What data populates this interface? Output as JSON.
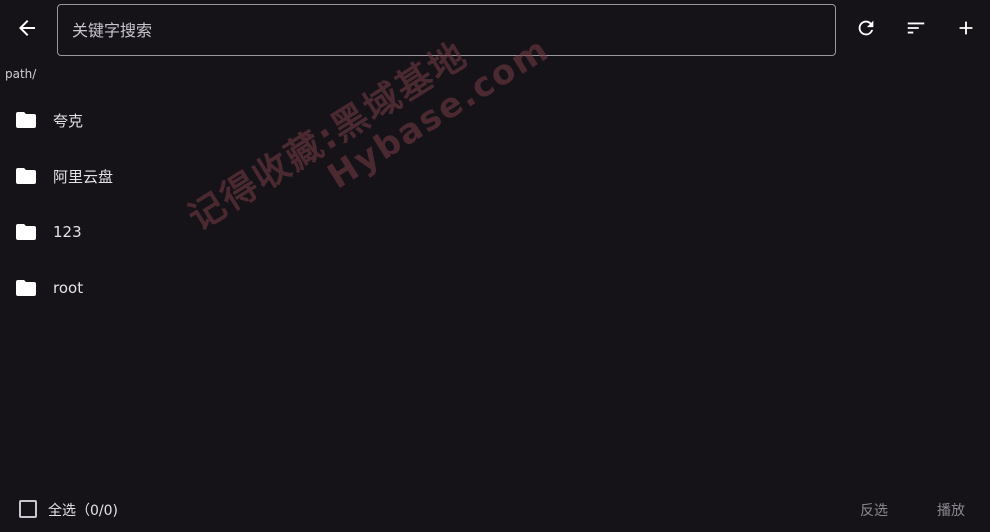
{
  "search": {
    "placeholder": "关键字搜索",
    "value": ""
  },
  "header": {
    "back_icon": "arrow-left-icon",
    "refresh_icon": "refresh-icon",
    "sort_icon": "sort-icon",
    "add_icon": "plus-icon"
  },
  "path": "path/",
  "folders": [
    {
      "name": "夸克",
      "icon": "folder-icon"
    },
    {
      "name": "阿里云盘",
      "icon": "folder-icon"
    },
    {
      "name": "123",
      "icon": "folder-icon"
    },
    {
      "name": "root",
      "icon": "folder-icon"
    }
  ],
  "watermark": {
    "line1": "记得收藏:黑域基地",
    "line2": "Hybase.com"
  },
  "bottom": {
    "select_all_label": "全选（0/0)",
    "select_all_checked": false,
    "invert_label": "反选",
    "play_label": "播放"
  },
  "colors": {
    "background": "#151318",
    "text": "#e6e1e5",
    "disabled_text": "#8c8891",
    "outline": "#9a979c"
  }
}
